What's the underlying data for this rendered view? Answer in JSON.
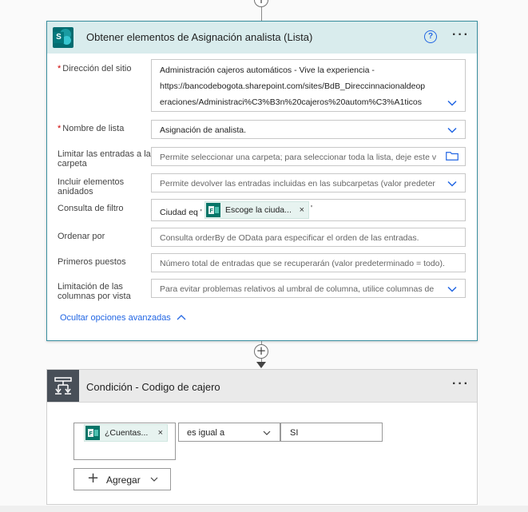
{
  "action_card": {
    "title": "Obtener elementos de Asignación analista (Lista)",
    "menu": "···",
    "help": "?",
    "icon_letter": "S",
    "fields": {
      "site": {
        "label": "Dirección del sitio",
        "required": "*",
        "lines": [
          "Administración cajeros automáticos - Vive la experiencia -",
          "https://bancodebogota.sharepoint.com/sites/BdB_Direccinnacionaldeop",
          "eraciones/Administraci%C3%B3n%20cajeros%20autom%C3%A1ticos"
        ]
      },
      "list": {
        "label": "Nombre de lista",
        "required": "*",
        "value": "Asignación de analista."
      },
      "folder": {
        "label": "Limitar las entradas a la carpeta",
        "placeholder": "Permite seleccionar una carpeta; para seleccionar toda la lista, deje este v"
      },
      "nested": {
        "label": "Incluir elementos anidados",
        "placeholder": "Permite devolver las entradas incluidas en las subcarpetas (valor predeter"
      },
      "filter": {
        "label": "Consulta de filtro",
        "prefix": "Ciudad eq '",
        "token": "Escoge la ciuda...",
        "token_close": "×",
        "suffix": "'"
      },
      "orderby": {
        "label": "Ordenar por",
        "placeholder": "Consulta orderBy de OData para especificar el orden de las entradas."
      },
      "top": {
        "label": "Primeros puestos",
        "placeholder": "Número total de entradas que se recuperarán (valor predeterminado = todo)."
      },
      "columns": {
        "label": "Limitación de las columnas por vista",
        "placeholder": "Para evitar problemas relativos al umbral de columna, utilice columnas de"
      }
    },
    "advanced_link": "Ocultar opciones avanzadas"
  },
  "connector": {
    "plus": "+"
  },
  "condition_card": {
    "title": "Condición - Codigo de cajero",
    "menu": "···",
    "left_token": "¿Cuentas...",
    "left_token_close": "×",
    "operator": "es igual a",
    "value": "SI",
    "add_button": "Agregar",
    "add_plus": "+"
  },
  "colors": {
    "action_header": "#d9eced",
    "action_border": "#3a8fa0",
    "sharepoint": "#036c70",
    "link": "#2266e3",
    "token_bg": "#e7f3f0",
    "condition_icon": "#484f58"
  }
}
